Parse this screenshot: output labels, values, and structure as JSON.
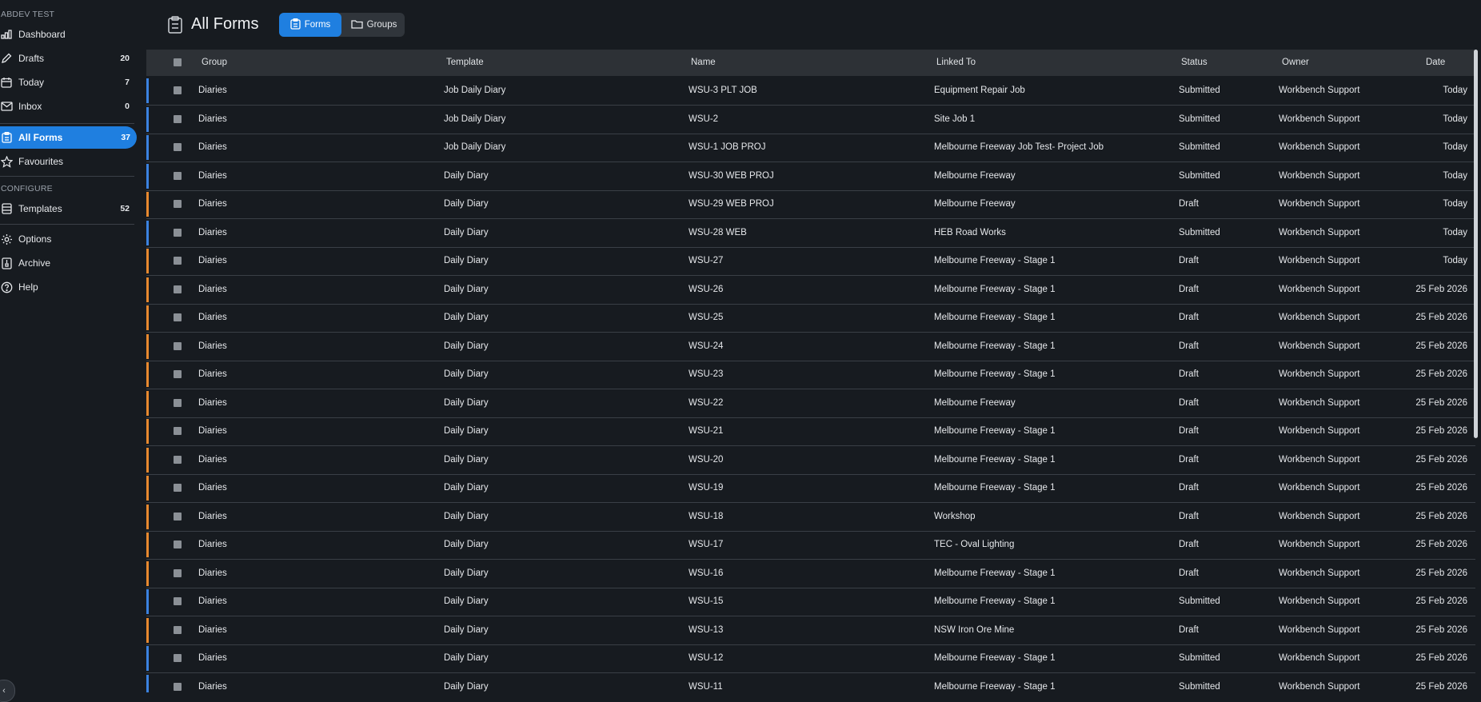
{
  "workspace": "ABDEV TEST",
  "nav": [
    {
      "name": "nav-dashboard",
      "icon": "bar-chart-icon",
      "label": "Dashboard",
      "count": ""
    },
    {
      "name": "nav-drafts",
      "icon": "pencil-icon",
      "label": "Drafts",
      "count": "20"
    },
    {
      "name": "nav-today",
      "icon": "calendar-icon",
      "label": "Today",
      "count": "7"
    },
    {
      "name": "nav-inbox",
      "icon": "mail-icon",
      "label": "Inbox",
      "count": "0"
    }
  ],
  "nav_main": [
    {
      "name": "nav-all-forms",
      "icon": "clipboard-icon",
      "label": "All Forms",
      "count": "37",
      "active": true
    },
    {
      "name": "nav-favourites",
      "icon": "star-icon",
      "label": "Favourites",
      "count": ""
    }
  ],
  "configure_label": "CONFIGURE",
  "nav_config": [
    {
      "name": "nav-templates",
      "icon": "template-icon",
      "label": "Templates",
      "count": "52"
    }
  ],
  "nav_bottom": [
    {
      "name": "nav-options",
      "icon": "gear-icon",
      "label": "Options"
    },
    {
      "name": "nav-archive",
      "icon": "archive-icon",
      "label": "Archive"
    },
    {
      "name": "nav-help",
      "icon": "help-icon",
      "label": "Help"
    }
  ],
  "header": {
    "title": "All Forms",
    "tabs": [
      {
        "label": "Forms",
        "icon": "clipboard-icon",
        "active": true
      },
      {
        "label": "Groups",
        "icon": "folder-icon",
        "active": false
      }
    ]
  },
  "colors": {
    "accent": "#1f7fe0",
    "submitted": "#3b82e0",
    "draft": "#e8892f"
  },
  "table": {
    "columns": [
      "Group",
      "Template",
      "Name",
      "Linked To",
      "Status",
      "Owner",
      "Date"
    ],
    "rows": [
      {
        "group": "Diaries",
        "template": "Job Daily Diary",
        "name": "WSU-3 PLT JOB",
        "linked": "Equipment Repair Job",
        "status": "Submitted",
        "owner": "Workbench Support",
        "date": "Today"
      },
      {
        "group": "Diaries",
        "template": "Job Daily Diary",
        "name": "WSU-2",
        "linked": "Site Job 1",
        "status": "Submitted",
        "owner": "Workbench Support",
        "date": "Today"
      },
      {
        "group": "Diaries",
        "template": "Job Daily Diary",
        "name": "WSU-1 JOB PROJ",
        "linked": "Melbourne Freeway Job Test- Project Job",
        "status": "Submitted",
        "owner": "Workbench Support",
        "date": "Today"
      },
      {
        "group": "Diaries",
        "template": "Daily Diary",
        "name": "WSU-30 WEB PROJ",
        "linked": "Melbourne Freeway",
        "status": "Submitted",
        "owner": "Workbench Support",
        "date": "Today"
      },
      {
        "group": "Diaries",
        "template": "Daily Diary",
        "name": "WSU-29 WEB PROJ",
        "linked": "Melbourne Freeway",
        "status": "Draft",
        "owner": "Workbench Support",
        "date": "Today"
      },
      {
        "group": "Diaries",
        "template": "Daily Diary",
        "name": "WSU-28 WEB",
        "linked": "HEB Road Works",
        "status": "Submitted",
        "owner": "Workbench Support",
        "date": "Today"
      },
      {
        "group": "Diaries",
        "template": "Daily Diary",
        "name": "WSU-27",
        "linked": "Melbourne Freeway - Stage 1",
        "status": "Draft",
        "owner": "Workbench Support",
        "date": "Today"
      },
      {
        "group": "Diaries",
        "template": "Daily Diary",
        "name": "WSU-26",
        "linked": "Melbourne Freeway - Stage 1",
        "status": "Draft",
        "owner": "Workbench Support",
        "date": "25 Feb 2026"
      },
      {
        "group": "Diaries",
        "template": "Daily Diary",
        "name": "WSU-25",
        "linked": "Melbourne Freeway - Stage 1",
        "status": "Draft",
        "owner": "Workbench Support",
        "date": "25 Feb 2026"
      },
      {
        "group": "Diaries",
        "template": "Daily Diary",
        "name": "WSU-24",
        "linked": "Melbourne Freeway - Stage 1",
        "status": "Draft",
        "owner": "Workbench Support",
        "date": "25 Feb 2026"
      },
      {
        "group": "Diaries",
        "template": "Daily Diary",
        "name": "WSU-23",
        "linked": "Melbourne Freeway - Stage 1",
        "status": "Draft",
        "owner": "Workbench Support",
        "date": "25 Feb 2026"
      },
      {
        "group": "Diaries",
        "template": "Daily Diary",
        "name": "WSU-22",
        "linked": "Melbourne Freeway",
        "status": "Draft",
        "owner": "Workbench Support",
        "date": "25 Feb 2026"
      },
      {
        "group": "Diaries",
        "template": "Daily Diary",
        "name": "WSU-21",
        "linked": "Melbourne Freeway - Stage 1",
        "status": "Draft",
        "owner": "Workbench Support",
        "date": "25 Feb 2026"
      },
      {
        "group": "Diaries",
        "template": "Daily Diary",
        "name": "WSU-20",
        "linked": "Melbourne Freeway - Stage 1",
        "status": "Draft",
        "owner": "Workbench Support",
        "date": "25 Feb 2026"
      },
      {
        "group": "Diaries",
        "template": "Daily Diary",
        "name": "WSU-19",
        "linked": "Melbourne Freeway - Stage 1",
        "status": "Draft",
        "owner": "Workbench Support",
        "date": "25 Feb 2026"
      },
      {
        "group": "Diaries",
        "template": "Daily Diary",
        "name": "WSU-18",
        "linked": "Workshop",
        "status": "Draft",
        "owner": "Workbench Support",
        "date": "25 Feb 2026"
      },
      {
        "group": "Diaries",
        "template": "Daily Diary",
        "name": "WSU-17",
        "linked": "TEC - Oval Lighting",
        "status": "Draft",
        "owner": "Workbench Support",
        "date": "25 Feb 2026"
      },
      {
        "group": "Diaries",
        "template": "Daily Diary",
        "name": "WSU-16",
        "linked": "Melbourne Freeway - Stage 1",
        "status": "Draft",
        "owner": "Workbench Support",
        "date": "25 Feb 2026"
      },
      {
        "group": "Diaries",
        "template": "Daily Diary",
        "name": "WSU-15",
        "linked": "Melbourne Freeway - Stage 1",
        "status": "Submitted",
        "owner": "Workbench Support",
        "date": "25 Feb 2026"
      },
      {
        "group": "Diaries",
        "template": "Daily Diary",
        "name": "WSU-13",
        "linked": "NSW Iron Ore Mine",
        "status": "Draft",
        "owner": "Workbench Support",
        "date": "25 Feb 2026"
      },
      {
        "group": "Diaries",
        "template": "Daily Diary",
        "name": "WSU-12",
        "linked": "Melbourne Freeway - Stage 1",
        "status": "Submitted",
        "owner": "Workbench Support",
        "date": "25 Feb 2026"
      },
      {
        "group": "Diaries",
        "template": "Daily Diary",
        "name": "WSU-11",
        "linked": "Melbourne Freeway - Stage 1",
        "status": "Submitted",
        "owner": "Workbench Support",
        "date": "25 Feb 2026"
      }
    ]
  }
}
